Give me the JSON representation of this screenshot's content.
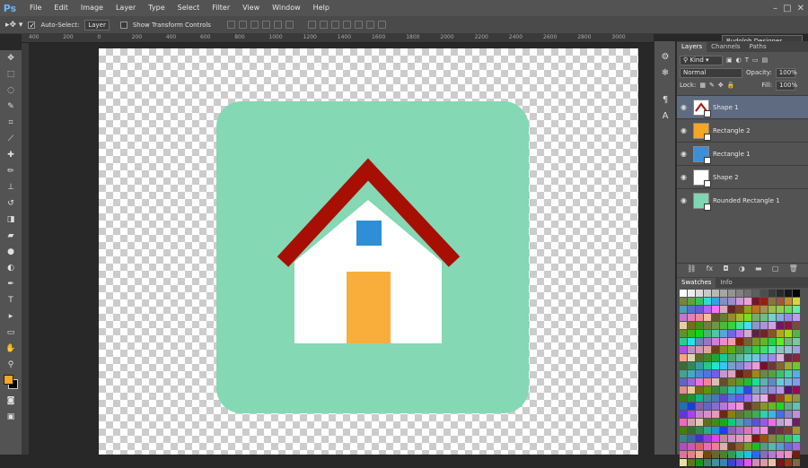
{
  "app": {
    "logo": "Ps"
  },
  "menu": [
    "File",
    "Edit",
    "Image",
    "Layer",
    "Type",
    "Select",
    "Filter",
    "View",
    "Window",
    "Help"
  ],
  "options": {
    "auto_select_label": "Auto-Select:",
    "auto_select_target": "Layer",
    "show_transform_label": "Show Transform Controls",
    "workspace": "Rudolph Designer"
  },
  "ruler_ticks": [
    "400",
    "200",
    "0",
    "200",
    "400",
    "600",
    "800",
    "1000",
    "1200",
    "1400",
    "1600",
    "1800",
    "2000",
    "2200",
    "2400",
    "2600",
    "2800",
    "3000"
  ],
  "panel": {
    "tabs": [
      "Layers",
      "Channels",
      "Paths"
    ],
    "kind_label": "Kind",
    "blend_mode": "Normal",
    "opacity_label": "Opacity:",
    "opacity_value": "100%",
    "lock_label": "Lock:",
    "fill_label": "Fill:",
    "fill_value": "100%",
    "layers": [
      {
        "name": "Shape 1",
        "selected": true,
        "thumb": "shape1"
      },
      {
        "name": "Rectangle 2",
        "selected": false,
        "thumb": "#f5a623"
      },
      {
        "name": "Rectangle 1",
        "selected": false,
        "thumb": "#3a8fd6"
      },
      {
        "name": "Shape 2",
        "selected": false,
        "thumb": "#ffffff"
      },
      {
        "name": "Rounded Rectangle 1",
        "selected": false,
        "thumb": "#7fd6b2"
      }
    ],
    "swatch_tabs": [
      "Swatches",
      "Info"
    ]
  },
  "artwork": {
    "background_color": "#84d8b4",
    "roof_color": "#a70f05",
    "wall_color": "#ffffff",
    "window_color": "#2e8fd6",
    "door_color": "#f9ad3a"
  },
  "colors": {
    "foreground": "#f5a623",
    "background": "#000000"
  }
}
